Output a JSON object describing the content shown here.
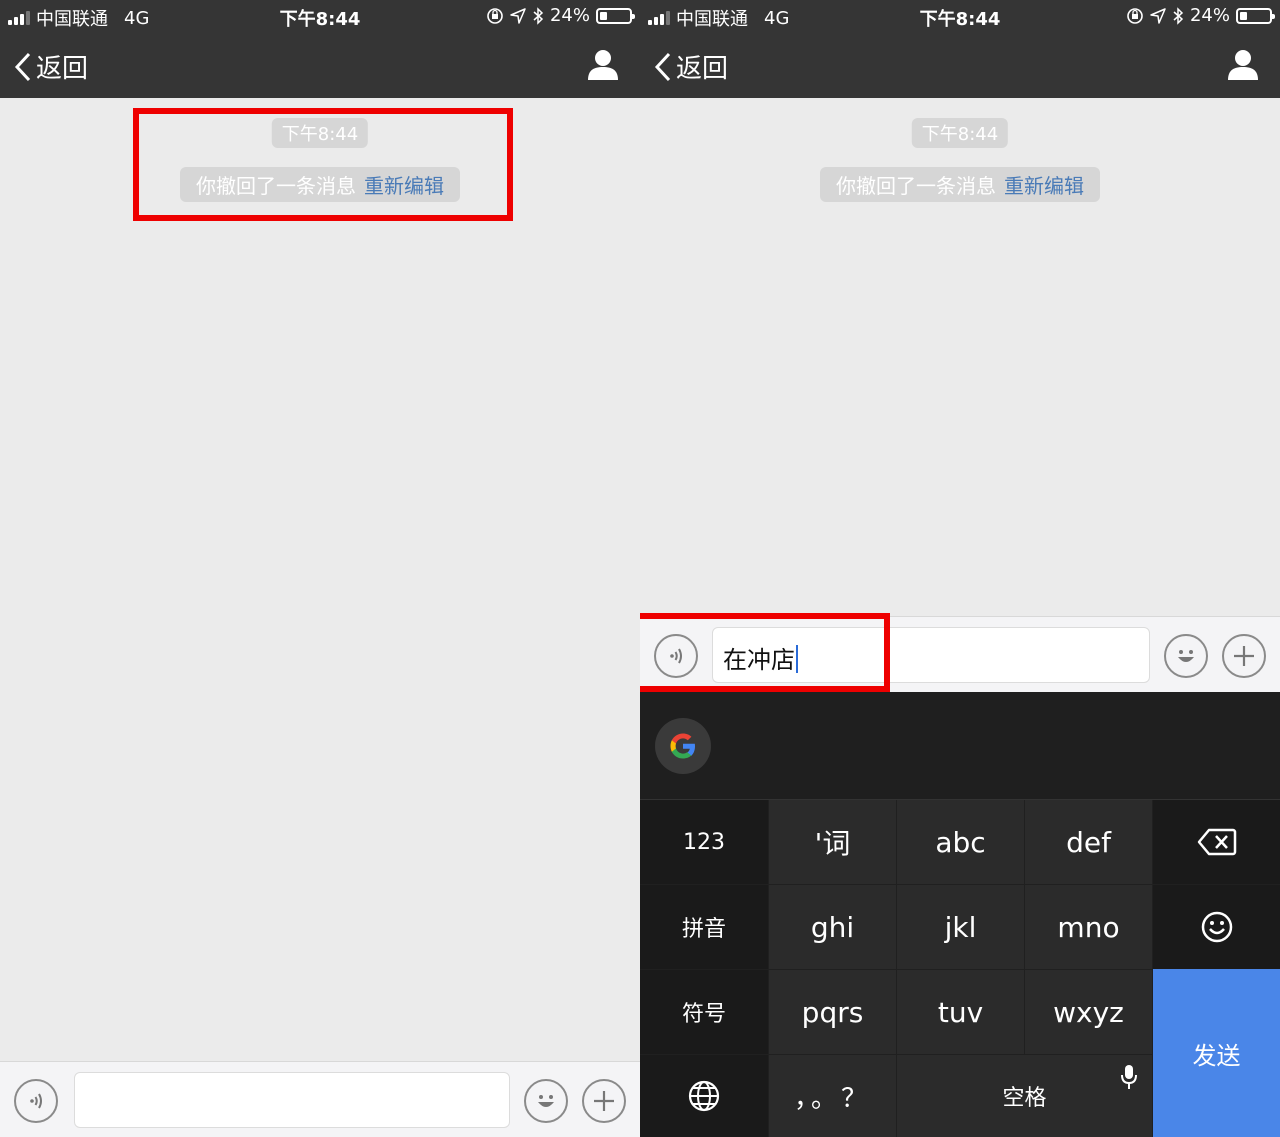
{
  "statusbar": {
    "carrier": "中国联通",
    "network": "4G",
    "time": "下午8:44",
    "battery": "24%"
  },
  "nav": {
    "back_label": "返回"
  },
  "chat": {
    "timestamp": "下午8:44",
    "recall_text": "你撤回了一条消息",
    "reedit_label": "重新编辑"
  },
  "input": {
    "value_left": "",
    "value_right": "在冲店"
  },
  "keyboard": {
    "row1": [
      "123",
      "'词",
      "abc",
      "def"
    ],
    "row2": [
      "拼音",
      "ghi",
      "jkl",
      "mno"
    ],
    "row3": [
      "符号",
      "pqrs",
      "tuv",
      "wxyz"
    ],
    "punct": "，。？",
    "space": "空格",
    "send": "发送"
  },
  "colors": {
    "highlight": "#ee0000",
    "link": "#4a7bb7",
    "send_key": "#4a86e8",
    "bar": "#353535"
  },
  "icons": [
    "signal-icon",
    "orientation-lock-icon",
    "location-icon",
    "bluetooth-icon",
    "battery-icon",
    "chevron-left-icon",
    "person-icon",
    "voice-icon",
    "emoji-icon",
    "plus-icon",
    "google-icon",
    "backspace-icon",
    "smiley-icon",
    "globe-icon",
    "microphone-icon"
  ]
}
